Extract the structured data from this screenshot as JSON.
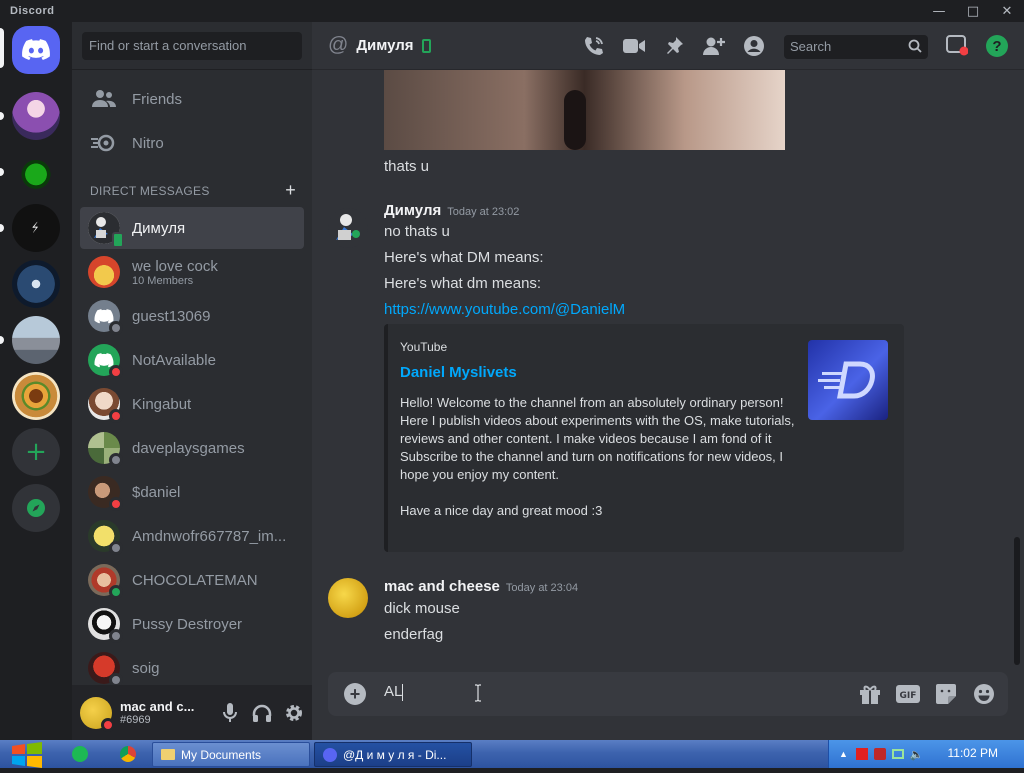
{
  "window": {
    "title": "Discord"
  },
  "colors": {
    "blurple": "#5865f2",
    "online": "#23a559",
    "dnd": "#f23f43",
    "idle": "#80848e",
    "link": "#00a8fc"
  },
  "sidebar": {
    "search_placeholder": "Find or start a conversation",
    "nav": [
      {
        "label": "Friends",
        "icon": "friends-icon"
      },
      {
        "label": "Nitro",
        "icon": "nitro-icon"
      }
    ],
    "dm_header": "DIRECT MESSAGES",
    "dms": [
      {
        "name": "Димуля",
        "sub": "",
        "status": "online-mobile",
        "active": true
      },
      {
        "name": "we love cock",
        "sub": "10 Members",
        "status": "",
        "active": false
      },
      {
        "name": "guest13069",
        "sub": "",
        "status": "offline",
        "active": false
      },
      {
        "name": "NotAvailable",
        "sub": "",
        "status": "dnd",
        "active": false
      },
      {
        "name": "Kingabut",
        "sub": "",
        "status": "dnd",
        "active": false
      },
      {
        "name": "daveplaysgames",
        "sub": "",
        "status": "offline",
        "active": false
      },
      {
        "name": "$daniel",
        "sub": "",
        "status": "dnd",
        "active": false
      },
      {
        "name": "Amdnwofr667787_im...",
        "sub": "",
        "status": "offline",
        "active": false
      },
      {
        "name": "CHOCOLATEMAN",
        "sub": "",
        "status": "online",
        "active": false
      },
      {
        "name": "Pussy Destroyer",
        "sub": "",
        "status": "offline",
        "active": false
      },
      {
        "name": "soig",
        "sub": "",
        "status": "offline",
        "active": false
      }
    ]
  },
  "user": {
    "name": "mac and c...",
    "tag": "#6969"
  },
  "channel": {
    "name": "Димуля"
  },
  "topbar": {
    "search_placeholder": "Search"
  },
  "messages": {
    "m0_line": "thats u",
    "m1": {
      "author": "Димуля",
      "time": "Today at 23:02",
      "lines": [
        "no thats u",
        "Here's what DM means:",
        "Here's what dm means:"
      ],
      "link": "https://www.youtube.com/@DanielM"
    },
    "embed": {
      "provider": "YouTube",
      "title": "Daniel Myslivets",
      "description": "Hello! Welcome to the channel from an absolutely ordinary person! Here I publish videos about experiments with the OS, make tutorials, reviews and other content. I make videos because I am fond of it\nSubscribe to the channel and turn on notifications for new videos, I hope you enjoy my content.\n\nHave a nice day and great mood :3"
    },
    "m2": {
      "author": "mac and cheese",
      "time": "Today at 23:04",
      "lines": [
        "dick mouse",
        "enderfag"
      ]
    }
  },
  "composer": {
    "text": "AL"
  },
  "taskbar": {
    "tasks": [
      {
        "label": "My Documents"
      },
      {
        "label": "@Д и м у л я - Di..."
      }
    ],
    "clock": "11:02 PM"
  }
}
